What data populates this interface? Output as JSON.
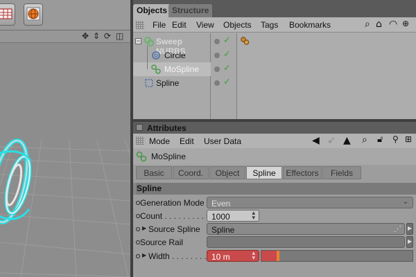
{
  "object_manager": {
    "tabs": [
      {
        "label": "Objects"
      },
      {
        "label": "Structure"
      }
    ],
    "menu": [
      "File",
      "Edit",
      "View",
      "Objects",
      "Tags",
      "Bookmarks"
    ],
    "tree": [
      {
        "label": "Sweep NURBS",
        "icon": "sweep-nurbs-icon"
      },
      {
        "label": "Circle",
        "icon": "circle-spline-icon"
      },
      {
        "label": "MoSpline",
        "icon": "mospline-icon"
      },
      {
        "label": "Spline",
        "icon": "spline-icon"
      }
    ]
  },
  "attributes": {
    "title": "Attributes",
    "menu": [
      "Mode",
      "Edit",
      "User Data"
    ],
    "object_name": "MoSpline",
    "tabs": [
      "Basic",
      "Coord.",
      "Object",
      "Spline",
      "Effectors",
      "Fields"
    ],
    "active_tab": "Spline",
    "section": "Spline",
    "params": {
      "generation_mode": {
        "label": "Generation Mode",
        "value": "Even"
      },
      "count": {
        "label": "Count",
        "dots": " . . . . . . . . . . .",
        "value": "1000"
      },
      "source_spline": {
        "label": "Source Spline",
        "value": "Spline"
      },
      "source_rail": {
        "label": "Source Rail",
        "value": ""
      },
      "width": {
        "label": "Width",
        "dots": " . . . . . . . . . .",
        "value": "10 m"
      }
    }
  },
  "colors": {
    "accent_highlight": "#c84a4a",
    "slider_knob": "#f07f30",
    "check_green": "#3aa13a",
    "spline_cyan": "#27e0e6"
  }
}
